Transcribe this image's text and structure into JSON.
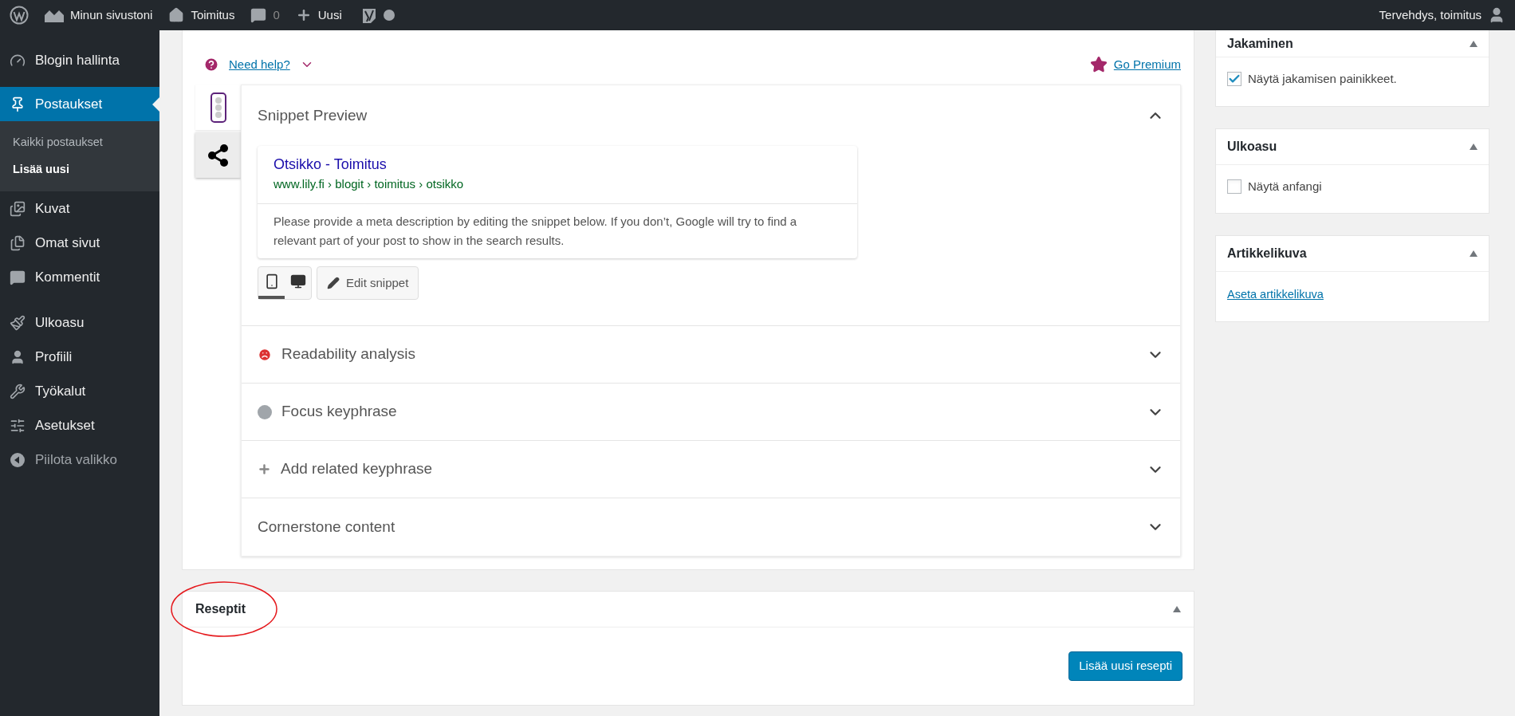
{
  "admin_bar": {
    "site_name": "Minun sivustoni",
    "site": "Toimitus",
    "comments": "0",
    "new_label": "Uusi",
    "greeting": "Tervehdys, toimitus"
  },
  "sidebar": {
    "items": [
      {
        "label": "Blogin hallinta",
        "selected": false,
        "kind": "menu"
      },
      {
        "label": "Postaukset",
        "selected": true,
        "kind": "menu",
        "children": [
          {
            "label": "Kaikki postaukset",
            "selected": false
          },
          {
            "label": "Lisää uusi",
            "selected": true
          }
        ]
      },
      {
        "label": "Kuvat",
        "selected": false,
        "kind": "menu"
      },
      {
        "label": "Omat sivut",
        "selected": false,
        "kind": "menu"
      },
      {
        "label": "Kommentit",
        "selected": false,
        "kind": "menu"
      },
      {
        "label": "Ulkoasu",
        "selected": false,
        "kind": "menu"
      },
      {
        "label": "Profiili",
        "selected": false,
        "kind": "menu"
      },
      {
        "label": "Työkalut",
        "selected": false,
        "kind": "menu"
      },
      {
        "label": "Asetukset",
        "selected": false,
        "kind": "menu"
      },
      {
        "label": "Piilota valikko",
        "selected": false,
        "kind": "collapse"
      }
    ]
  },
  "seo_box": {
    "help_link": "Need help?",
    "premium_link": "Go Premium",
    "side_tabs": [
      {
        "selected": true
      },
      {
        "selected": false
      }
    ],
    "snippet": {
      "title": "Snippet Preview",
      "expanded": true,
      "preview_title": "Otsikko - Toimitus",
      "preview_url": "www.lily.fi › blogit › toimitus › otsikko",
      "preview_description": "Please provide a meta description by editing the snippet below. If you don’t, Google will try to find a relevant part of your post to show in the search results.",
      "modes": [
        {
          "kind": "mobile",
          "selected": true
        },
        {
          "kind": "desktop",
          "selected": false
        }
      ],
      "edit_button": "Edit snippet"
    },
    "sections": [
      {
        "title": "Readability analysis",
        "kind": "bad-score",
        "expanded": false
      },
      {
        "title": "Focus keyphrase",
        "kind": "no-score",
        "expanded": false
      },
      {
        "title": "Add related keyphrase",
        "kind": "add",
        "expanded": false
      },
      {
        "title": "Cornerstone content",
        "kind": "plain",
        "expanded": false
      }
    ]
  },
  "recipes_box": {
    "title": "Reseptit",
    "button": "Lisää uusi resepti"
  },
  "side_boxes": [
    {
      "title": "Jakaminen",
      "kind": "checkbox",
      "label": "Näytä jakamisen painikkeet.",
      "checked": true
    },
    {
      "title": "Ulkoasu",
      "kind": "checkbox",
      "label": "Näytä anfangi",
      "checked": false
    },
    {
      "title": "Artikkelikuva",
      "kind": "link",
      "label": "Aseta artikkelikuva"
    }
  ]
}
